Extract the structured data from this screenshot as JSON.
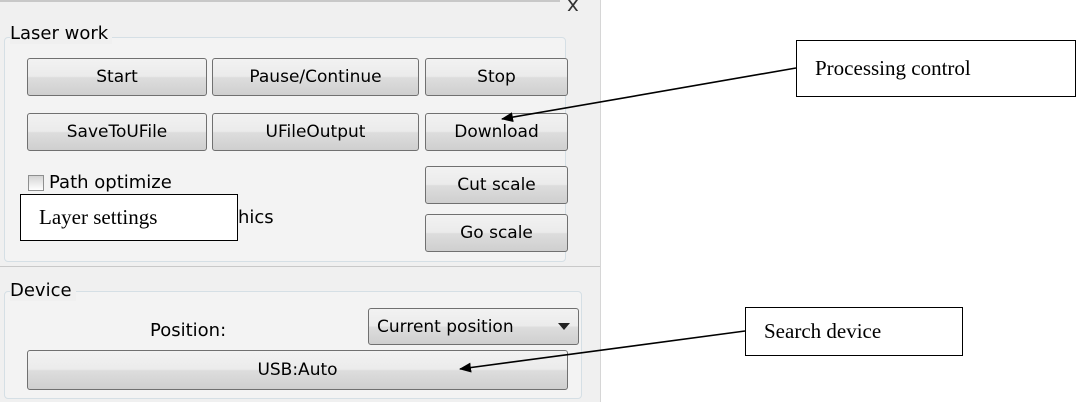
{
  "window": {
    "close_glyph": "x"
  },
  "laser_work": {
    "title": "Laser work",
    "buttons": {
      "start": "Start",
      "pause_continue": "Pause/Continue",
      "stop": "Stop",
      "save_to_ufile": "SaveToUFile",
      "ufile_output": "UFileOutput",
      "download": "Download",
      "cut_scale": "Cut scale",
      "go_scale": "Go scale"
    },
    "path_optimize_label": "Path optimize",
    "partial_label": "hics"
  },
  "device": {
    "title": "Device",
    "position_label": "Position:",
    "position_selected": "Current position",
    "usb_button": "USB:Auto"
  },
  "callouts": {
    "processing_control": "Processing control",
    "layer_settings": "Layer settings",
    "search_device": "Search device"
  }
}
